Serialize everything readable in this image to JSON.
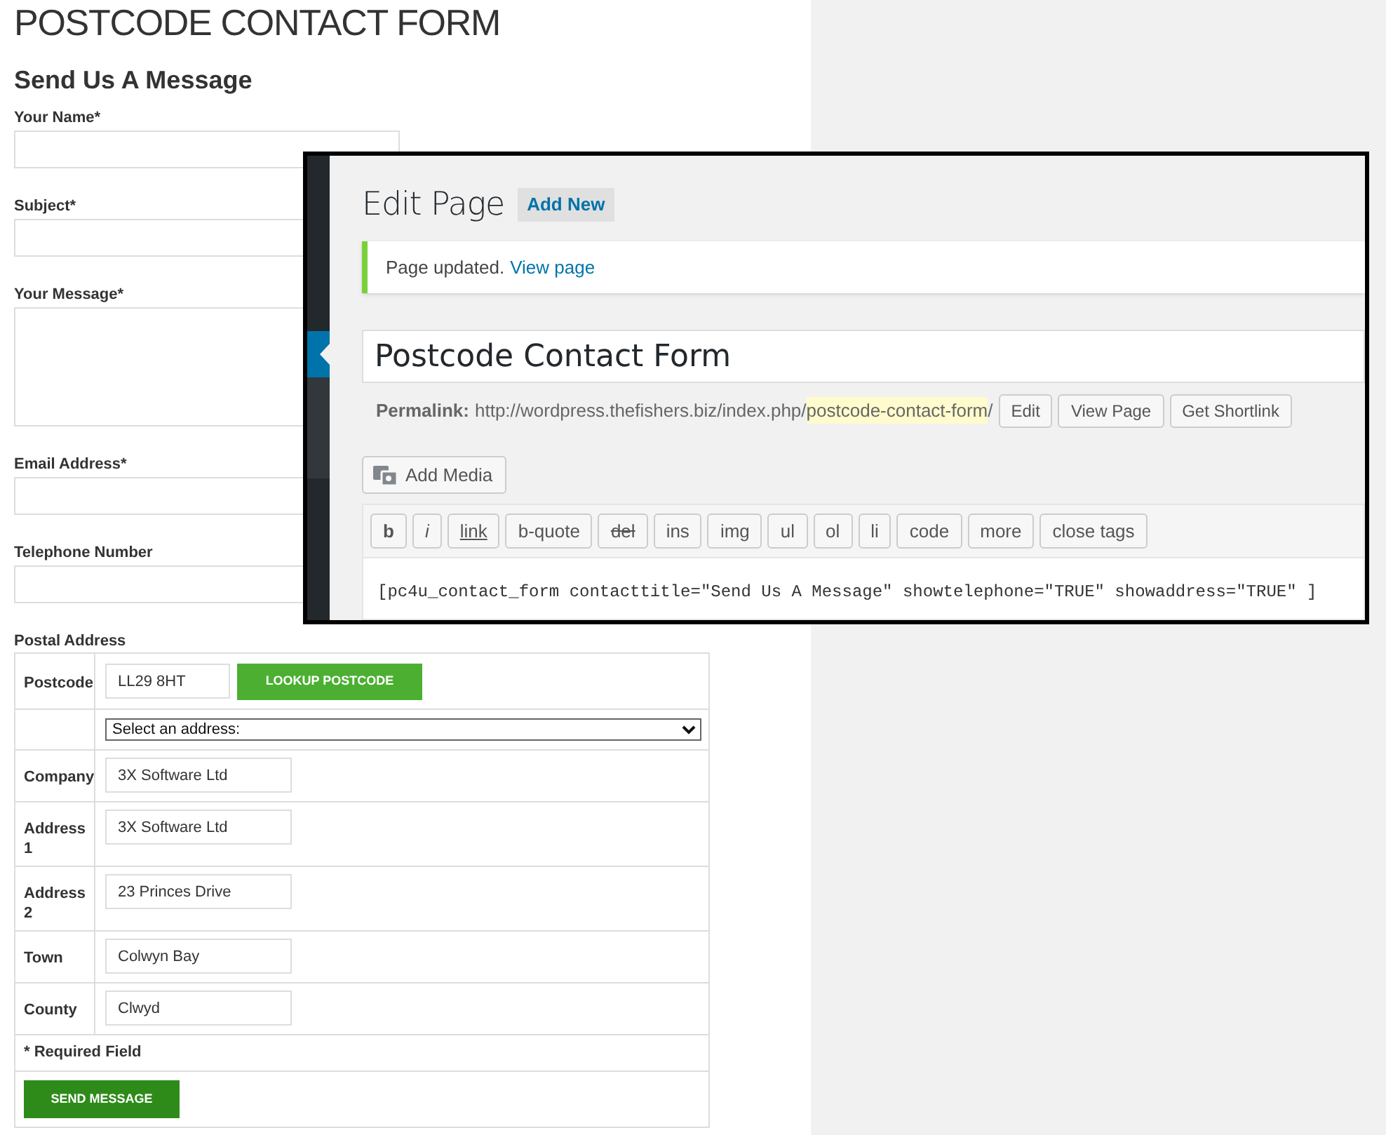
{
  "form": {
    "title": "POSTCODE CONTACT FORM",
    "heading": "Send Us A Message",
    "fields": [
      {
        "label": "Your Name*",
        "kind": "input"
      },
      {
        "label": "Subject*",
        "kind": "input"
      },
      {
        "label": "Your Message*",
        "kind": "textarea"
      },
      {
        "label": "Email Address*",
        "kind": "input"
      },
      {
        "label": "Telephone Number",
        "kind": "input"
      }
    ],
    "postal_address": {
      "label": "Postal Address",
      "postcode": {
        "label": "Postcode",
        "value": "LL29 8HT",
        "button": "LOOKUP POSTCODE"
      },
      "address_select": "Select an address:",
      "rows": [
        {
          "label": "Company",
          "value": "3X Software Ltd"
        },
        {
          "label": "Address 1",
          "value": "3X Software Ltd"
        },
        {
          "label": "Address 2",
          "value": "23 Princes Drive"
        },
        {
          "label": "Town",
          "value": "Colwyn Bay"
        },
        {
          "label": "County",
          "value": "Clwyd"
        }
      ]
    },
    "required_note": "* Required Field",
    "send_button": "SEND MESSAGE"
  },
  "editor": {
    "title": "Edit Page",
    "add_new": "Add New",
    "notice": {
      "text": "Page updated.",
      "link": "View page"
    },
    "page_title": "Postcode Contact Form",
    "permalink": {
      "label": "Permalink:",
      "base_url": "http://wordpress.thefishers.biz/index.php/",
      "slug": "postcode-contact-form",
      "suffix": "/",
      "buttons": [
        "Edit",
        "View Page",
        "Get Shortlink"
      ]
    },
    "add_media": "Add Media",
    "toolbar": [
      {
        "label": "b",
        "kind": "bold"
      },
      {
        "label": "i",
        "kind": "italic"
      },
      {
        "label": "link",
        "kind": "link"
      },
      {
        "label": "b-quote",
        "kind": "plain"
      },
      {
        "label": "del",
        "kind": "strike"
      },
      {
        "label": "ins",
        "kind": "plain"
      },
      {
        "label": "img",
        "kind": "plain"
      },
      {
        "label": "ul",
        "kind": "plain"
      },
      {
        "label": "ol",
        "kind": "plain"
      },
      {
        "label": "li",
        "kind": "plain"
      },
      {
        "label": "code",
        "kind": "plain"
      },
      {
        "label": "more",
        "kind": "plain"
      },
      {
        "label": "close tags",
        "kind": "plain"
      }
    ],
    "content": "[pc4u_contact_form contacttitle=\"Send Us A Message\" showtelephone=\"TRUE\" showaddress=\"TRUE\" ]"
  }
}
